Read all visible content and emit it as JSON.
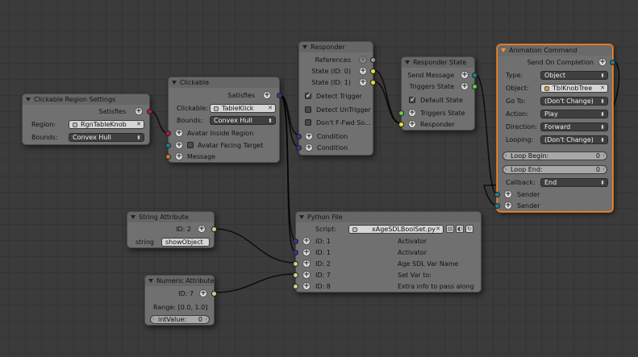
{
  "colors": {
    "socket_red": "#a8202e",
    "socket_yellow": "#e7e03a",
    "socket_green": "#5fd14a",
    "socket_purple": "#403090",
    "socket_teal": "#1f7f8a",
    "socket_orange": "#c77a28",
    "socket_olive": "#cfd08a",
    "socket_gray": "#9a9a9a",
    "active_border": "#f08a2c"
  },
  "clickable_region": {
    "title": "Clickable Region Settings",
    "satisfies_label": "Satisfies",
    "region_label": "Region:",
    "region_value": "RgnTableKnob",
    "bounds_label": "Bounds:",
    "bounds_value": "Convex Hull"
  },
  "clickable": {
    "title": "Clickable",
    "satisfies_label": "Satisfies",
    "clickable_label": "Clickable:",
    "clickable_value": "TableKlick",
    "bounds_label": "Bounds:",
    "bounds_value": "Convex Hull",
    "avatar_inside": "Avatar Inside Region",
    "avatar_facing": "Avatar Facing Target",
    "message": "Message"
  },
  "responder": {
    "title": "Responder",
    "references": "References",
    "state0": "State (ID: 0)",
    "state1": "State (ID: 1)",
    "detect_trigger": "Detect Trigger",
    "detect_untrigger": "Detect UnTrigger",
    "dont_ffwd": "Don't F-Fwd So...",
    "condition1": "Condition",
    "condition2": "Condition"
  },
  "responder_state": {
    "title": "Responder State",
    "send_message": "Send Message",
    "triggers_state_out": "Triggers State",
    "default_state": "Default State",
    "triggers_state_in": "Triggers State",
    "responder": "Responder"
  },
  "animation_command": {
    "title": "Animation Command",
    "send_on_completion": "Send On Completion",
    "type_label": "Type:",
    "type_value": "Object",
    "object_label": "Object:",
    "object_value": "TblKnobTree",
    "goto_label": "Go To:",
    "goto_value": "(Don't Change)",
    "action_label": "Action:",
    "action_value": "Play",
    "direction_label": "Direction:",
    "direction_value": "Forward",
    "looping_label": "Looping:",
    "looping_value": "(Don't Change)",
    "loop_begin_label": "Loop Begin:",
    "loop_begin_value": "0",
    "loop_end_label": "Loop End:",
    "loop_end_value": "0",
    "callback_label": "Callback:",
    "callback_value": "End",
    "sender1": "Sender",
    "sender2": "Sender"
  },
  "string_attribute": {
    "title": "String Attribute",
    "id_label": "ID: 2",
    "string_label": "string",
    "string_value": "showObject"
  },
  "numeric_attribute": {
    "title": "Numeric Attribute",
    "id_label": "ID: 7",
    "range_label": "Range: [0.0, 1.0]",
    "int_label": "intValue:",
    "int_value": "0"
  },
  "python_file": {
    "title": "Python File",
    "script_label": "Script:",
    "script_value": "xAgeSDLBoolSet.py",
    "rows": [
      {
        "id": "ID: 1",
        "desc": "Activator"
      },
      {
        "id": "ID: 1",
        "desc": "Activator"
      },
      {
        "id": "ID: 2",
        "desc": "Age SDL Var Name"
      },
      {
        "id": "ID: 7",
        "desc": "Set Var to:"
      },
      {
        "id": "ID: 8",
        "desc": "Extra info to pass along"
      }
    ]
  }
}
